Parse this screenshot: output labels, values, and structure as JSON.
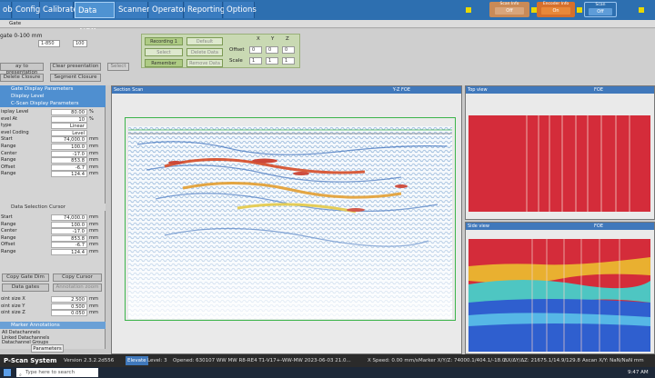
{
  "tabs": [
    "ob",
    "Config",
    "Calibrate",
    "Data View",
    "Scanner",
    "Operator",
    "Reporting",
    "Options"
  ],
  "top_buttons": [
    {
      "label": "Scan Info",
      "value": "Off",
      "color": "#c98a57"
    },
    {
      "label": "Encoder Info",
      "value": "On",
      "color": "#d6702c"
    },
    {
      "label": "Scan",
      "value": "Off",
      "color": "#2d6fb0"
    }
  ],
  "row2": {
    "label": "Gate"
  },
  "setup": {
    "gate_title": "gate 0-100 mm",
    "range_from": "1-850",
    "range_to": "100",
    "btn_copy_presentation": "ay to presentation",
    "btn_clear_presentation": "Clear presentation",
    "btn_select": "Select",
    "btn_delete_closure": "Delete Closure",
    "btn_segment_closure": "Segment Closure",
    "recording": "Recording 1",
    "default": "Default",
    "select": "Select",
    "remember": "Remember",
    "delete_data": "Delete Data",
    "remove_data": "Remove Data",
    "xyz": [
      "X",
      "Y",
      "Z"
    ],
    "offset_label": "Offset",
    "scale_label": "Scale",
    "offset_vals": [
      "0",
      "0",
      "0"
    ],
    "scale_vals": [
      "1",
      "1",
      "1"
    ]
  },
  "left_panel": {
    "display_level_hdr": "Display Level",
    "sections": [
      "Gate Display Parameters",
      "C-Scan Display Parameters"
    ],
    "rows1": [
      {
        "n": "isplay Level",
        "v": "80.00",
        "u": "%"
      },
      {
        "n": "evel At",
        "v": "10",
        "u": "%"
      },
      {
        "n": "type",
        "v": "Linear",
        "u": ""
      },
      {
        "n": "evel Coding",
        "v": "Level",
        "u": ""
      },
      {
        "n": "Start",
        "v": "74,000.0",
        "u": "mm"
      },
      {
        "n": "Range",
        "v": "100.0",
        "u": "mm"
      },
      {
        "n": "Center",
        "v": "-17.0",
        "u": "mm"
      },
      {
        "n": "Range",
        "v": "853.8",
        "u": "mm"
      },
      {
        "n": "Offset",
        "v": "-6.7",
        "u": "mm"
      },
      {
        "n": "Range",
        "v": "124.4",
        "u": "mm"
      }
    ],
    "data_selection": "Data Selection Cursor",
    "rows2": [
      {
        "n": "Start",
        "v": "74,000.0",
        "u": "mm"
      },
      {
        "n": "Range",
        "v": "100.0",
        "u": "mm"
      },
      {
        "n": "Center",
        "v": "-17.0",
        "u": "mm"
      },
      {
        "n": "Range",
        "v": "853.8",
        "u": "mm"
      },
      {
        "n": "Offset",
        "v": "-6.7",
        "u": "mm"
      },
      {
        "n": "Range",
        "v": "124.4",
        "u": "mm"
      }
    ],
    "copy_btns": [
      "Copy Gate Dim",
      "Copy Cursor"
    ],
    "gate_btns": [
      "Data gates",
      "Annotation zoom"
    ],
    "rows3": [
      {
        "n": "oint size X",
        "v": "2.500",
        "u": "mm"
      },
      {
        "n": "oint size Y",
        "v": "0.500",
        "u": "mm"
      },
      {
        "n": "oint size Z",
        "v": "0.050",
        "u": "mm"
      }
    ],
    "marker_hdr": "Marker Annotations",
    "list": [
      "All Datachannels",
      "Linked Datachannels",
      "Datachannel Groups"
    ],
    "bottom_tab": "Parameters"
  },
  "panels": {
    "section": {
      "title": "Section Scan",
      "ctrl": "Y-Z FOE"
    },
    "top": {
      "title": "Top view",
      "ctrl": "FOE"
    },
    "side": {
      "title": "Side view",
      "ctrl": "FOE"
    }
  },
  "status": {
    "app": "P-Scan System",
    "version": "Version 2.3.2.2d556",
    "mode": "Elevate",
    "level": "Level: 3",
    "opened": "Opened: 630107 WW MW R8-RE4 T1-V17+-WW-MW 2023-06-03 21.0...",
    "speed": "X Speed: 0.00 mm/s",
    "marker": "Marker X/Y/Z: 74000.1/404.1/-18.0",
    "delta": "ΔX/ΔY/ΔZ: 21675.1/14.9/129.8",
    "ascan": "Ascan X/Y: NaN/NaN mm"
  },
  "taskbar": {
    "search": "Type here to search",
    "time": "9:47 AM"
  },
  "colors": {
    "menu": "#2d6fb0",
    "panelhead": "#4078bb",
    "red": "#d42c3a"
  }
}
